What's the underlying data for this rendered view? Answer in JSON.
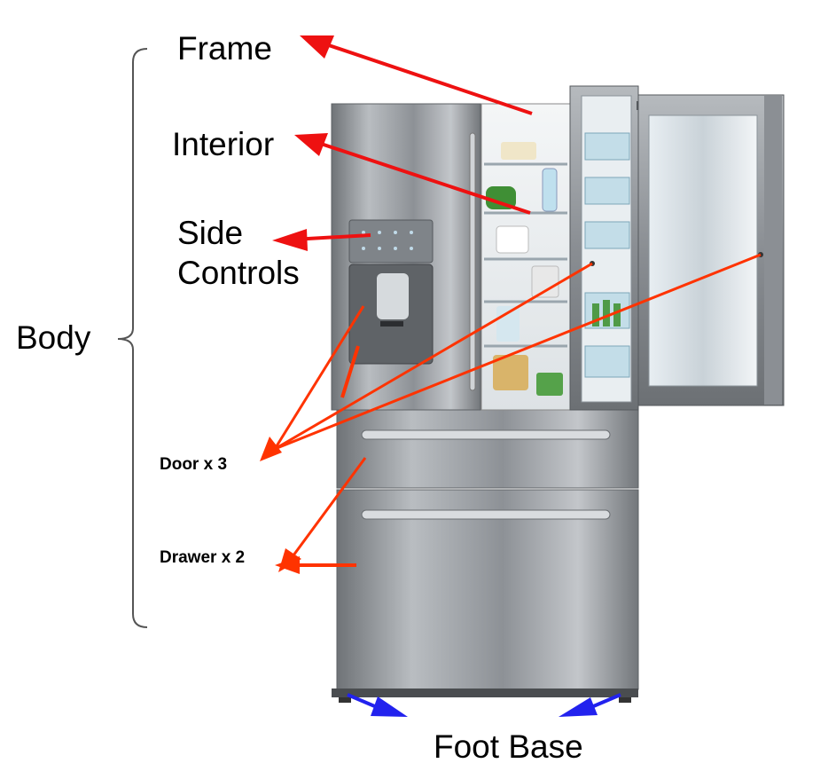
{
  "labels": {
    "frame": "Frame",
    "interior": "Interior",
    "side_controls_line1": "Side",
    "side_controls_line2": "Controls",
    "body": "Body",
    "door": "Door x 3",
    "drawer": "Drawer x 2",
    "foot_base": "Foot Base"
  },
  "colors": {
    "arrow_red": "#ee1111",
    "arrow_orange_red": "#ff3300",
    "arrow_blue": "#2222ee",
    "bracket": "#555555",
    "steel": "#9a9ea3"
  },
  "icons": {
    "refrigerator": "french-door-refrigerator-illustration"
  }
}
